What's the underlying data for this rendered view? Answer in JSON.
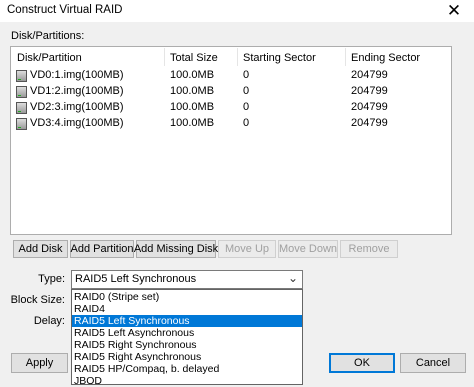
{
  "window": {
    "title": "Construct Virtual RAID",
    "close_glyph": "✕"
  },
  "disks_label": "Disk/Partitions:",
  "columns": [
    "Disk/Partition",
    "Total Size",
    "Starting Sector",
    "Ending Sector"
  ],
  "rows": [
    {
      "name": "VD0:1.img(100MB)",
      "size": "100.0MB",
      "start": "0",
      "end": "204799"
    },
    {
      "name": "VD1:2.img(100MB)",
      "size": "100.0MB",
      "start": "0",
      "end": "204799"
    },
    {
      "name": "VD2:3.img(100MB)",
      "size": "100.0MB",
      "start": "0",
      "end": "204799"
    },
    {
      "name": "VD3:4.img(100MB)",
      "size": "100.0MB",
      "start": "0",
      "end": "204799"
    }
  ],
  "toolbar": {
    "add_disk": "Add Disk",
    "add_partition": "Add Partition",
    "add_missing_disk": "Add Missing Disk",
    "move_up": "Move Up",
    "move_down": "Move Down",
    "remove": "Remove"
  },
  "fields": {
    "type_label": "Type:",
    "block_size_label": "Block Size:",
    "delay_label": "Delay:",
    "type_value": "RAID5 Left Synchronous"
  },
  "type_options": [
    "RAID0 (Stripe set)",
    "RAID4",
    "RAID5 Left Synchronous",
    "RAID5 Left Asynchronous",
    "RAID5 Right Synchronous",
    "RAID5 Right Asynchronous",
    "RAID5 HP/Compaq, b. delayed",
    "JBOD"
  ],
  "selected_option_index": 2,
  "footer": {
    "apply": "Apply",
    "ok": "OK",
    "cancel": "Cancel"
  },
  "colors": {
    "selection": "#0078d7",
    "primary_border": "#0078d7"
  }
}
